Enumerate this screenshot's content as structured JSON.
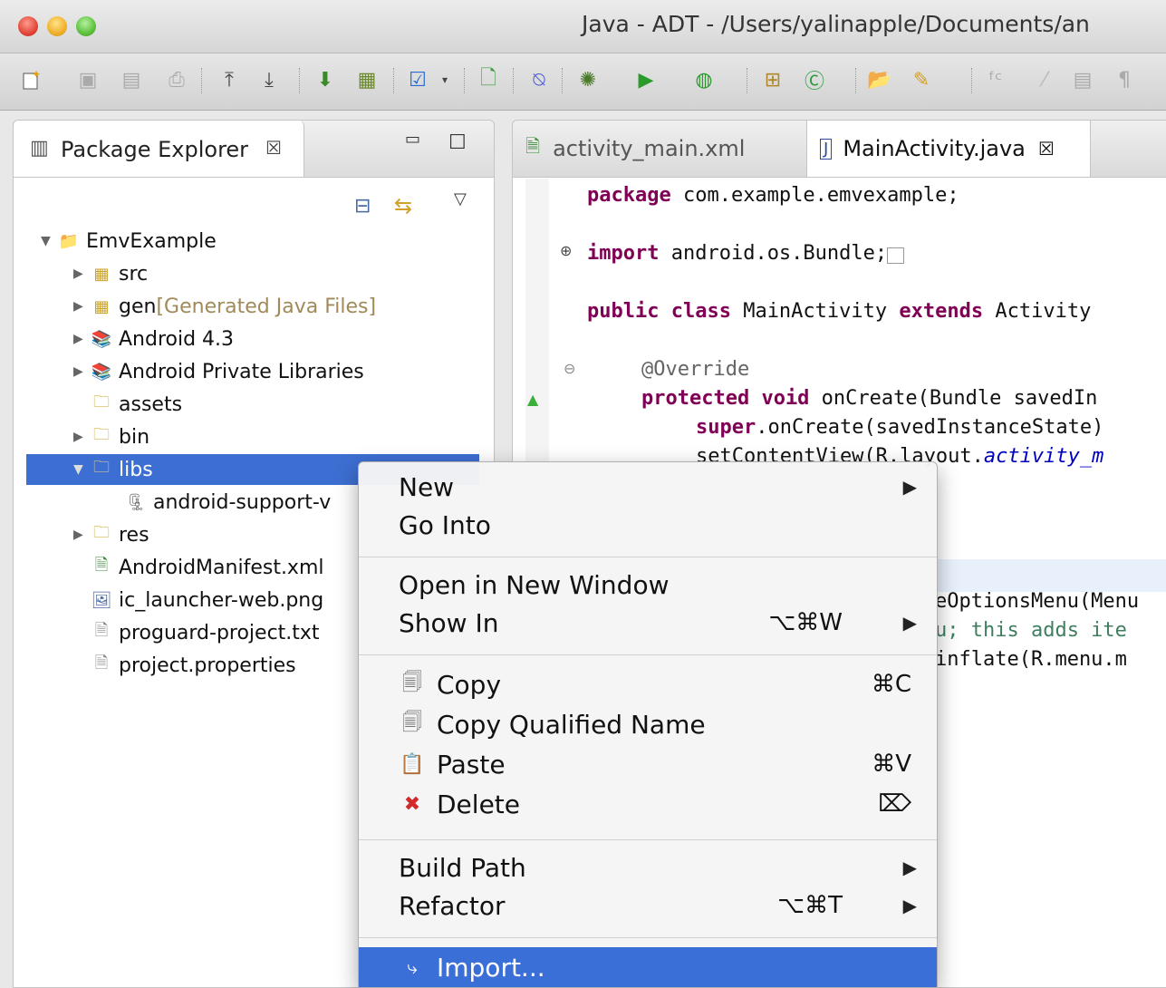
{
  "window": {
    "title": "Java - ADT - /Users/yalinapple/Documents/an"
  },
  "toolbar": {
    "icons": [
      "new-wizard-icon",
      "save-icon",
      "save-all-icon",
      "print-icon",
      "upload-icon",
      "download-icon",
      "open-type-icon",
      "open-resource-icon",
      "checkbox-icon",
      "new-java-file-icon",
      "toggle-mark-icon",
      "debug-icon",
      "run-icon",
      "external-tools-icon",
      "new-java-package-icon",
      "new-java-class-icon",
      "open-project-icon",
      "search-icon",
      "text-icon",
      "edit-icon",
      "outline-icon",
      "show-whitespace-icon"
    ]
  },
  "package_explorer": {
    "tab_label": "Package Explorer",
    "tab_close": "☒",
    "minimize": "▭",
    "maximize": "☐",
    "tree": [
      {
        "label": "EmvExample",
        "decoration": ""
      },
      {
        "label": "src",
        "decoration": ""
      },
      {
        "label": "gen",
        "decoration": " [Generated Java Files]"
      },
      {
        "label": "Android 4.3",
        "decoration": ""
      },
      {
        "label": "Android Private Libraries",
        "decoration": ""
      },
      {
        "label": "assets",
        "decoration": ""
      },
      {
        "label": "bin",
        "decoration": ""
      },
      {
        "label": "libs",
        "decoration": ""
      },
      {
        "label": "android-support-v",
        "decoration": ""
      },
      {
        "label": "res",
        "decoration": ""
      },
      {
        "label": "AndroidManifest.xml",
        "decoration": ""
      },
      {
        "label": "ic_launcher-web.png",
        "decoration": ""
      },
      {
        "label": "proguard-project.txt",
        "decoration": ""
      },
      {
        "label": "project.properties",
        "decoration": ""
      }
    ]
  },
  "editor": {
    "tabs": [
      {
        "label": "activity_main.xml"
      },
      {
        "label": "MainActivity.java",
        "close": "☒"
      }
    ],
    "code": {
      "line1_kw": "package",
      "line1_rest": " com.example.emvexample;",
      "line2_kw": "import",
      "line2_rest": " android.os.Bundle;",
      "line3_kw1": "public class",
      "line3_mid": " MainActivity ",
      "line3_kw2": "extends",
      "line3_rest": " Activity",
      "line4": "@Override",
      "line5_kw": "protected void",
      "line5_rest": " onCreate(Bundle savedIn",
      "line6_kw": "super",
      "line6_rest": ".onCreate(savedInstanceState)",
      "line7_rest": "setContentView(R.layout.",
      "line7_it": "activity_m",
      "line8": "eOptionsMenu(Menu",
      "line9": "u; this adds ite",
      "line10": "inflate(R.menu.m"
    }
  },
  "context_menu": {
    "new": "New",
    "go_into": "Go Into",
    "open_new_window": "Open in New Window",
    "show_in": "Show In",
    "show_in_shortcut": "⌥⌘W",
    "copy": "Copy",
    "copy_shortcut": "⌘C",
    "copy_qualified": "Copy Qualified Name",
    "paste": "Paste",
    "paste_shortcut": "⌘V",
    "delete": "Delete",
    "delete_shortcut": "⌦",
    "build_path": "Build Path",
    "refactor": "Refactor",
    "refactor_shortcut": "⌥⌘T",
    "import": "Import..."
  }
}
